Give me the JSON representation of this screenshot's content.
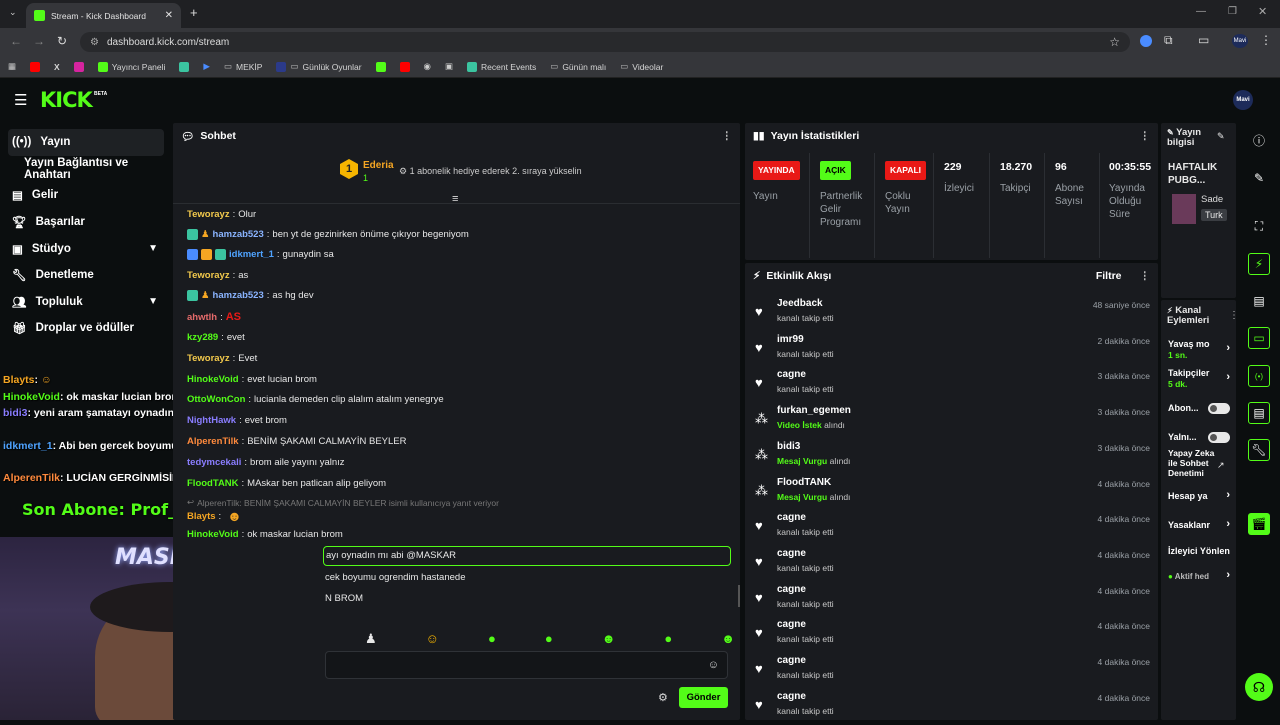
{
  "browser": {
    "tab_title": "Stream - Kick Dashboard",
    "url": "dashboard.kick.com/stream",
    "bookmarks": [
      "Yayıncı Paneli",
      "MEKİP",
      "Günlük Oyunlar",
      "Recent Events",
      "Günün malı",
      "Videolar"
    ]
  },
  "header": {
    "logo": "KICK",
    "beta": "BETA",
    "avatar_label": "Mavi"
  },
  "sidebar": {
    "items": [
      {
        "label": "Yayın",
        "icon": "broadcast-icon"
      },
      {
        "label": "Yayın Bağlantısı ve Anahtarı",
        "icon": ""
      },
      {
        "label": "Gelir",
        "icon": "revenue-icon"
      },
      {
        "label": "Başarılar",
        "icon": "trophy-icon"
      },
      {
        "label": "Stüdyo",
        "icon": "studio-icon"
      },
      {
        "label": "Denetleme",
        "icon": "wrench-icon"
      },
      {
        "label": "Topluluk",
        "icon": "community-icon"
      },
      {
        "label": "Droplar ve ödüller",
        "icon": "gift-icon"
      }
    ]
  },
  "overlay": {
    "lines": [
      {
        "user": "Blayts",
        "text": ":",
        "color": "#f5a623"
      },
      {
        "user": "HinokeVoid",
        "text": ": ok maskar lucian brom",
        "color": "#53fc18"
      },
      {
        "user": "bidi3",
        "text": ": yeni aram şamatayı oynadın mı abi @MASKAR",
        "color": "#8a7dff"
      },
      {
        "user": "idkmert_1",
        "text": ": Abi ben gercek boyumu ogrendim hastanede",
        "color": "#4fa3ff"
      },
      {
        "user": "AlperenTilk",
        "text": ": LUCİAN GERGİNMİSİN BROM",
        "color": "#ff8a3d"
      }
    ],
    "last_sub": "Son Abone: Prof_SET",
    "cam_label": "MASKAR"
  },
  "chat": {
    "title": "Sohbet",
    "pinned_user": "Ederia",
    "pinned_count": "1",
    "pinned_text": "1 abonelik hediye ederek 2. sıraya yükselin",
    "messages": [
      {
        "user": "Teworayz",
        "text": "Olur",
        "color": "#f2c94c"
      },
      {
        "user": "hamzab523",
        "text": "ben yt de gezinirken önüme çıkıyor begeniyom",
        "color": "#8ab4ff"
      },
      {
        "user": "idkmert_1",
        "text": "gunaydin sa",
        "color": "#4fa3ff"
      },
      {
        "user": "Teworayz",
        "text": "as",
        "color": "#f2c94c"
      },
      {
        "user": "hamzab523",
        "text": "as hg dev",
        "color": "#8ab4ff"
      },
      {
        "user": "ahwtlh",
        "text": "AS",
        "color": "#e66b6b"
      },
      {
        "user": "kzy289",
        "text": "evet",
        "color": "#53fc18"
      },
      {
        "user": "Teworayz",
        "text": "Evet",
        "color": "#f2c94c"
      },
      {
        "user": "HinokeVoid",
        "text": "evet lucian brom",
        "color": "#53fc18"
      },
      {
        "user": "OttoWonCon",
        "text": "lucianla demeden clip alalım atalım yenegrye",
        "color": "#53fc18"
      },
      {
        "user": "NightHawk",
        "text": "evet brom",
        "color": "#8a7dff"
      },
      {
        "user": "AlperenTilk",
        "text": "BENİM ŞAKAMI CALMAYİN BEYLER",
        "color": "#ff8a3d"
      },
      {
        "user": "tedymcekali",
        "text": "brom aile yayını yalnız",
        "color": "#8a7dff"
      },
      {
        "user": "FloodTANK",
        "text": "MAskar ben patlican alip geliyom",
        "color": "#53fc18"
      },
      {
        "user": "",
        "text": "AlperenTilk: BENİM ŞAKAMI CALMAYİN BEYLER isimli kullanıcıya yanıt veriyor",
        "color": "#777"
      },
      {
        "user": "Blayts",
        "text": "",
        "color": "#f5a623"
      },
      {
        "user": "HinokeVoid",
        "text": "ok maskar lucian brom",
        "color": "#53fc18"
      },
      {
        "user": "",
        "text": "ayı oynadın mı abi @MASKAR",
        "color": "#fff"
      },
      {
        "user": "",
        "text": "cek boyumu ogrendim hastanede",
        "color": "#fff"
      },
      {
        "user": "",
        "text": "N BROM",
        "color": "#fff"
      }
    ],
    "send_label": "Gönder"
  },
  "stats": {
    "title": "Yayın İstatistikleri",
    "cols": [
      {
        "pill": "YAYINDA",
        "pill_color": "#e91916",
        "label": "Yayın"
      },
      {
        "pill": "AÇIK",
        "pill_color": "#53fc18",
        "label": "Partnerlik Gelir Programı"
      },
      {
        "pill": "KAPALI",
        "pill_color": "#e91916",
        "label": "Çoklu Yayın"
      },
      {
        "value": "229",
        "label": "İzleyici"
      },
      {
        "value": "18.270",
        "label": "Takipçi"
      },
      {
        "value": "96",
        "label": "Abone Sayısı"
      },
      {
        "value": "00:35:55",
        "label": "Yayında Olduğu Süre"
      }
    ]
  },
  "activity": {
    "title": "Etkinlik Akışı",
    "filter": "Filtre",
    "items": [
      {
        "name": "Jeedback",
        "sub": "kanalı takip etti",
        "time": "48 saniye önce",
        "type": "heart"
      },
      {
        "name": "imr99",
        "sub": "kanalı takip etti",
        "time": "2 dakika önce",
        "type": "heart"
      },
      {
        "name": "cagne",
        "sub": "kanalı takip etti",
        "time": "3 dakika önce",
        "type": "heart"
      },
      {
        "name": "furkan_egemen",
        "sub_hl": "Video İstek",
        "sub": "alındı",
        "time": "3 dakika önce",
        "type": "reward"
      },
      {
        "name": "bidi3",
        "sub_hl": "Mesaj Vurgu",
        "sub": "alındı",
        "time": "3 dakika önce",
        "type": "reward"
      },
      {
        "name": "FloodTANK",
        "sub_hl": "Mesaj Vurgu",
        "sub": "alındı",
        "time": "4 dakika önce",
        "type": "reward"
      },
      {
        "name": "cagne",
        "sub": "kanalı takip etti",
        "time": "4 dakika önce",
        "type": "heart"
      },
      {
        "name": "cagne",
        "sub": "kanalı takip etti",
        "time": "4 dakika önce",
        "type": "heart"
      },
      {
        "name": "cagne",
        "sub": "kanalı takip etti",
        "time": "4 dakika önce",
        "type": "heart"
      },
      {
        "name": "cagne",
        "sub": "kanalı takip etti",
        "time": "4 dakika önce",
        "type": "heart"
      },
      {
        "name": "cagne",
        "sub": "kanalı takip etti",
        "time": "4 dakika önce",
        "type": "heart"
      },
      {
        "name": "cagne",
        "sub": "kanalı takip etti",
        "time": "4 dakika önce",
        "type": "heart"
      }
    ]
  },
  "info": {
    "title": "Yayın bilgisi",
    "stream_title": "HAFTALIK PUBG...",
    "tags": [
      "Sade",
      "Turk"
    ]
  },
  "channel": {
    "title": "Kanal Eylemleri",
    "rows": [
      {
        "label": "Yavaş mo",
        "value": "1 sn.",
        "kind": "arrow"
      },
      {
        "label": "Takipçiler",
        "value": "5 dk.",
        "kind": "arrow"
      },
      {
        "label": "Abon...",
        "kind": "toggle"
      },
      {
        "label": "Yalnı...",
        "kind": "toggle"
      },
      {
        "label": "Yapay Zeka ile Sohbet Denetimi",
        "kind": "link"
      },
      {
        "label": "Hesap ya",
        "kind": "arrow"
      },
      {
        "label": "Yasaklanr",
        "kind": "arrow"
      },
      {
        "label": "İzleyici Yönlen",
        "kind": "none"
      },
      {
        "label": "Aktif hed",
        "kind": "arrow"
      }
    ]
  }
}
